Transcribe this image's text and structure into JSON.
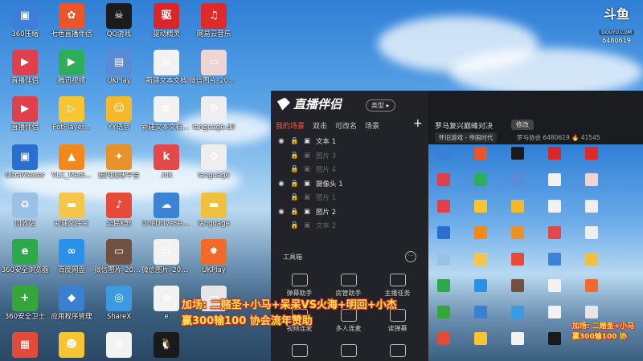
{
  "desktop_icons": [
    {
      "label": "360压缩",
      "color": "#3d7fd8",
      "glyph": "▣"
    },
    {
      "label": "七色直播伴侣",
      "color": "#e8562a",
      "glyph": "✿"
    },
    {
      "label": "QQ游戏",
      "color": "#1b1b1b",
      "glyph": "☠"
    },
    {
      "label": "驱动精灵",
      "color": "#d8262b",
      "glyph": "驱"
    },
    {
      "label": "网易云音乐",
      "color": "#e02a2a",
      "glyph": "♫"
    },
    {
      "label": "直播伴侣",
      "color": "#e0404a",
      "glyph": "▶"
    },
    {
      "label": "腾讯视频",
      "color": "#2fae5a",
      "glyph": "▶"
    },
    {
      "label": "UKPlay",
      "color": "#5a8bd6",
      "glyph": "▤"
    },
    {
      "label": "新建文本文档",
      "color": "#f2f2f2",
      "glyph": "≡"
    },
    {
      "label": "微信图片_2022010...",
      "color": "#f0d4d4",
      "glyph": "▭"
    },
    {
      "label": "直播伴侣",
      "color": "#e0404a",
      "glyph": "▶"
    },
    {
      "label": "PotPlayer...",
      "color": "#f7c531",
      "glyph": "▷"
    },
    {
      "label": "YY语音",
      "color": "#f4b82a",
      "glyph": "☺"
    },
    {
      "label": "新建文本文档(2)",
      "color": "#f2f2f2",
      "glyph": "≡"
    },
    {
      "label": "language.dll",
      "color": "#eeeeee",
      "glyph": "⚙"
    },
    {
      "label": "UltraViewer",
      "color": "#2a6fd0",
      "glyph": "▣"
    },
    {
      "label": "VLC_Medi...",
      "color": "#f18a1a",
      "glyph": "▲"
    },
    {
      "label": "国内加速平台",
      "color": "#e8932a",
      "glyph": "✦"
    },
    {
      "label": ".lnk",
      "color": "#e24a4a",
      "glyph": "k"
    },
    {
      "label": "language",
      "color": "#eeeeee",
      "glyph": "⚙"
    },
    {
      "label": "回收站",
      "color": "#9bc1e6",
      "glyph": "♻"
    },
    {
      "label": "新建文件夹",
      "color": "#f5c64c",
      "glyph": "▬"
    },
    {
      "label": "全民K歌",
      "color": "#e84a3a",
      "glyph": "♪"
    },
    {
      "label": "OneDriveSetup",
      "color": "#3a83d6",
      "glyph": "☁"
    },
    {
      "label": "language",
      "color": "#f0c040",
      "glyph": "▬"
    },
    {
      "label": "360安全浏览器",
      "color": "#2da84a",
      "glyph": "e"
    },
    {
      "label": "百度网盘",
      "color": "#2a90e8",
      "glyph": "∞"
    },
    {
      "label": "微信图片_2021080...",
      "color": "#705040",
      "glyph": "▭"
    },
    {
      "label": "微信图片_2021082...",
      "color": "#f2f2f2",
      "glyph": "▭"
    },
    {
      "label": "UKPlay",
      "color": "#f26a2a",
      "glyph": "✸"
    },
    {
      "label": "360安全卫士",
      "color": "#35a638",
      "glyph": "+"
    },
    {
      "label": "应用程序管理",
      "color": "#3a7fd0",
      "glyph": "◆"
    },
    {
      "label": "ShareX",
      "color": "#3a9be0",
      "glyph": "◎"
    },
    {
      "label": "e",
      "color": "#f2f2f2",
      "glyph": "e"
    },
    {
      "label": "",
      "color": "#e6e6e6",
      "glyph": "▭"
    },
    {
      "label": "",
      "color": "#e24a3a",
      "glyph": "▦"
    },
    {
      "label": "",
      "color": "#f7c531",
      "glyph": "☻"
    },
    {
      "label": "",
      "color": "#f2f2f2",
      "glyph": "≡"
    },
    {
      "label": "",
      "color": "#1a1a1a",
      "glyph": "🐧"
    }
  ],
  "douyu": {
    "logo": "斗鱼",
    "badge": "DOUYU.COM",
    "room_id": "6480619"
  },
  "app": {
    "name": "直播伴侣",
    "type_button": "类型 ▸",
    "tabs": [
      "我的场景",
      "双击",
      "可改名",
      "场景"
    ],
    "plus": "+",
    "sources": [
      {
        "name": "文本 1",
        "visible": true
      },
      {
        "name": "图片 3",
        "visible": false
      },
      {
        "name": "图片 4",
        "visible": false
      },
      {
        "name": "摄像头 1",
        "visible": true
      },
      {
        "name": "图片 1",
        "visible": false
      },
      {
        "name": "图片 2",
        "visible": true
      },
      {
        "name": "文本 2",
        "visible": false
      }
    ],
    "toolbox_title": "工具箱",
    "more": "···",
    "tools": [
      "弹幕助手",
      "房管助手",
      "主播任务",
      "视频连麦",
      "多人连麦",
      "读弹幕",
      "",
      "",
      ""
    ],
    "room_title": "罗马复兴巅峰对决",
    "modify_button": "修改",
    "category": "怀旧游戏 - 帝国时代",
    "meta": "罗马协会  6480619   🔥 41545"
  },
  "overlay": {
    "line1": "加场: 二赌圣+小马+呆呆VS火海+明回+小杰",
    "line2": "赢300输100 协会流年赞助",
    "preview_line1": "加场: 二赌圣+小马",
    "preview_line2": "赢300输100 协"
  }
}
